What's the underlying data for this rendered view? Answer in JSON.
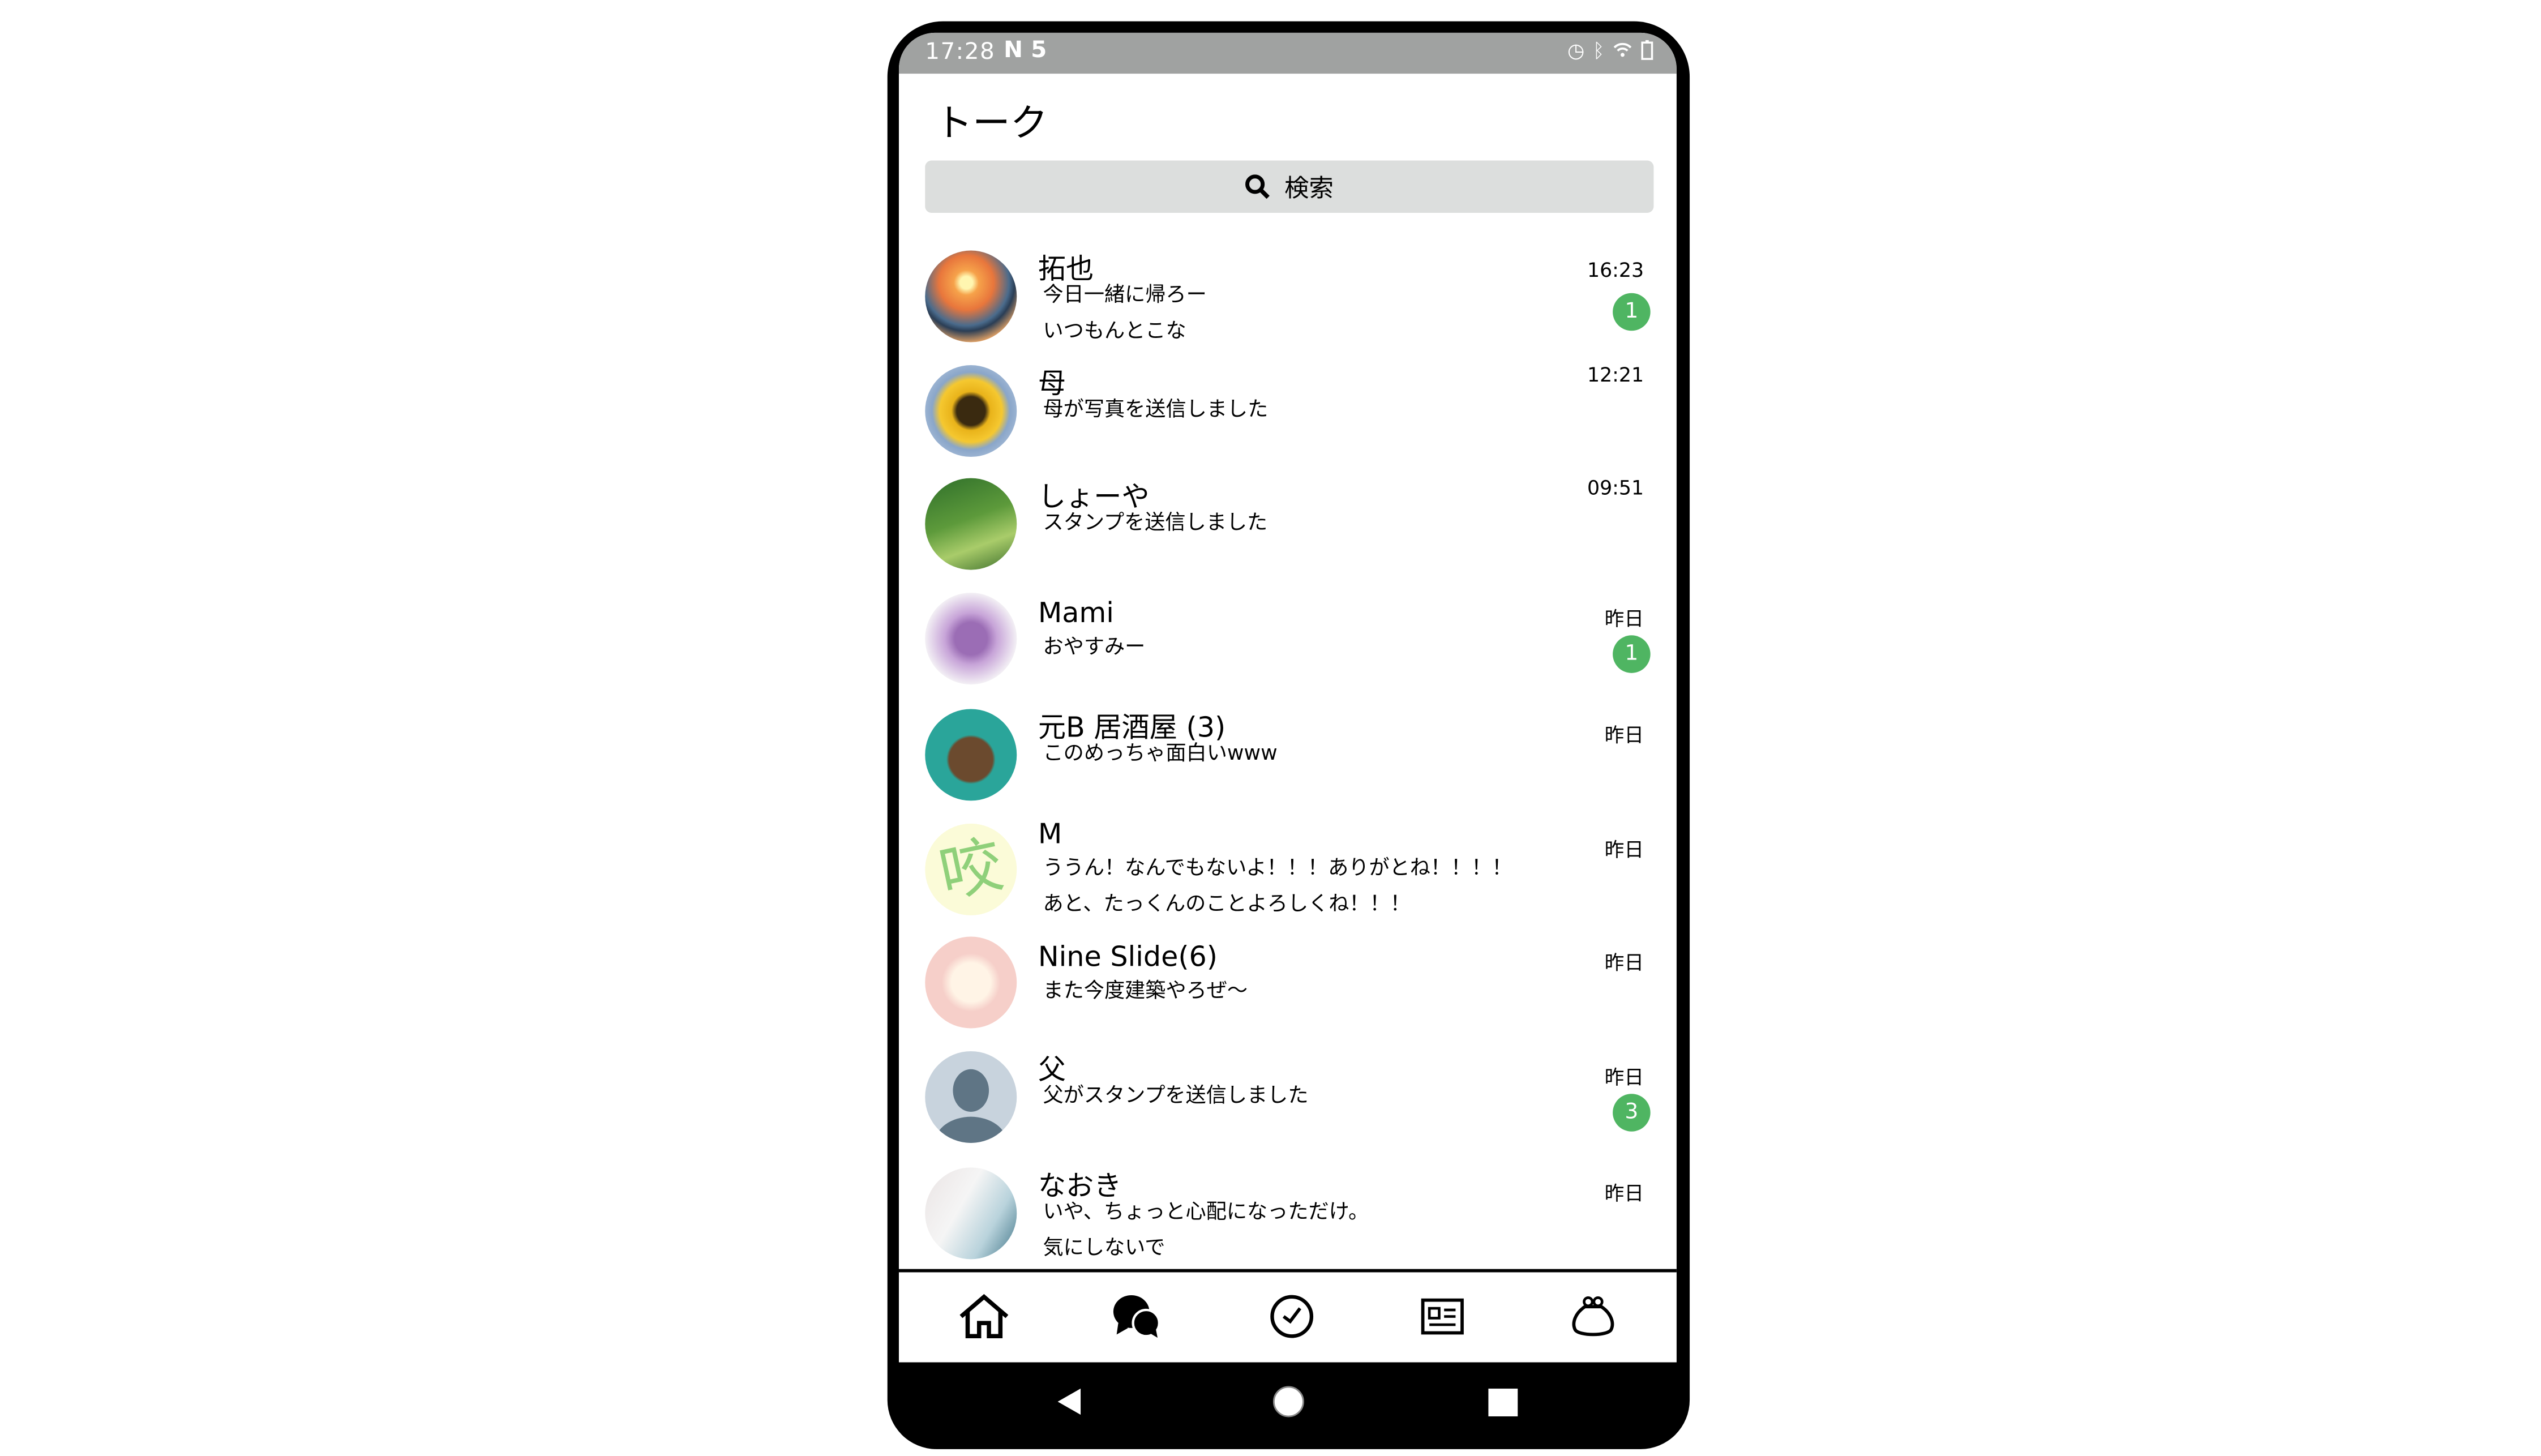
{
  "status_bar": {
    "time": "17:28",
    "notifications": "N 5",
    "icons": [
      "alarm-icon",
      "bluetooth-icon",
      "wifi-icon",
      "battery-icon"
    ]
  },
  "header": {
    "title": "トーク"
  },
  "search": {
    "label": "検索",
    "icon": "search-icon"
  },
  "colors": {
    "badge": "#4fb562",
    "status_bar": "#a0a2a1",
    "search_bg": "#dcdedd"
  },
  "chats": [
    {
      "name": "拓也",
      "lines": [
        "今日一緒に帰ろー",
        "いつもんとこな"
      ],
      "time": "16:23",
      "unread": "1"
    },
    {
      "name": "母",
      "lines": [
        "母が写真を送信しました"
      ],
      "time": "12:21",
      "unread": null
    },
    {
      "name": "しょーや",
      "lines": [
        "スタンプを送信しました"
      ],
      "time": "09:51",
      "unread": null
    },
    {
      "name": "Mami",
      "lines": [
        "おやすみー"
      ],
      "time": "昨日",
      "unread": "1"
    },
    {
      "name": "元B 居酒屋 (3)",
      "lines": [
        "このめっちゃ面白いwww"
      ],
      "time": "昨日",
      "unread": null
    },
    {
      "name": "M",
      "lines": [
        "ううん！なんでもないよ！！！ありがとね！！！！",
        "あと、たっくんのことよろしくね！！！"
      ],
      "time": "昨日",
      "unread": null
    },
    {
      "name": "Nine Slide(6)",
      "lines": [
        "また今度建築やろぜ～"
      ],
      "time": "昨日",
      "unread": null
    },
    {
      "name": "父",
      "lines": [
        "父がスタンプを送信しました"
      ],
      "time": "昨日",
      "unread": "3"
    },
    {
      "name": "なおき",
      "lines": [
        "いや、ちょっと心配になっただけ。",
        "気にしないで"
      ],
      "time": "昨日",
      "unread": null
    }
  ],
  "avatar_text": {
    "m": "咬"
  },
  "bottom_nav": [
    "home-icon",
    "chat-icon",
    "timeline-icon",
    "news-icon",
    "wallet-icon"
  ],
  "system_nav": [
    "back-icon",
    "home-circle-icon",
    "recents-icon"
  ]
}
